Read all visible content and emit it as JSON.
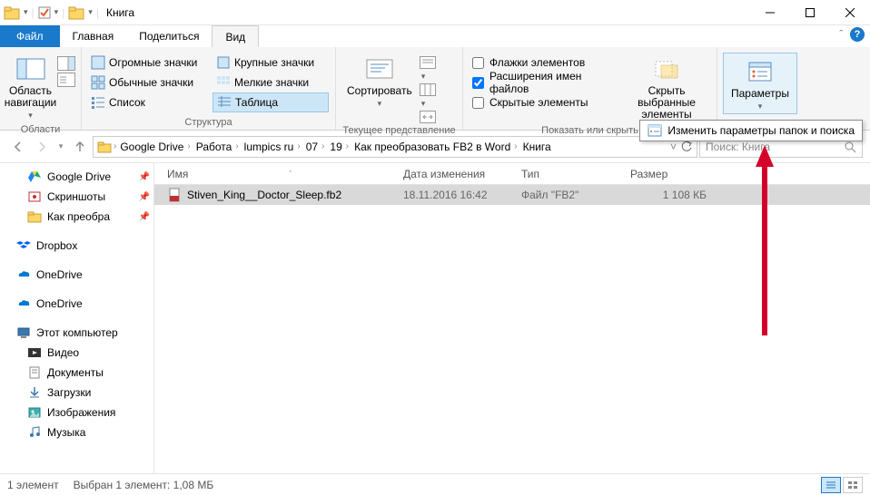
{
  "window_title": "Книга",
  "tabs": {
    "file": "Файл",
    "home": "Главная",
    "share": "Поделиться",
    "view": "Вид"
  },
  "ribbon": {
    "nav_pane": "Область навигации",
    "group_panes": "Области",
    "layout": {
      "huge": "Огромные значки",
      "large": "Крупные значки",
      "normal": "Обычные значки",
      "small": "Мелкие значки",
      "list": "Список",
      "table": "Таблица"
    },
    "group_layout": "Структура",
    "sort": "Сортировать",
    "group_view": "Текущее представление",
    "checks": {
      "boxes": "Флажки элементов",
      "ext": "Расширения имен файлов",
      "hidden": "Скрытые элементы"
    },
    "hide_selected": "Скрыть выбранные элементы",
    "group_show": "Показать или скрыть",
    "params": "Параметры",
    "tooltip": "Изменить параметры папок и поиска"
  },
  "breadcrumb": [
    "Google Drive",
    "Работа",
    "lumpics ru",
    "07",
    "19",
    "Как преобразовать FB2 в Word",
    "Книга"
  ],
  "search_placeholder": "Поиск: Книга",
  "columns": {
    "name": "Имя",
    "date": "Дата изменения",
    "type": "Тип",
    "size": "Размер"
  },
  "files": [
    {
      "name": "Stiven_King__Doctor_Sleep.fb2",
      "date": "18.11.2016 16:42",
      "type": "Файл \"FB2\"",
      "size": "1 108 КБ"
    }
  ],
  "sidebar": {
    "gdrive": "Google Drive",
    "screens": "Скриншоты",
    "convert": "Как преобра",
    "dropbox": "Dropbox",
    "onedrive": "OneDrive",
    "onedrive2": "OneDrive",
    "thispc": "Этот компьютер",
    "video": "Видео",
    "docs": "Документы",
    "downloads": "Загрузки",
    "pictures": "Изображения",
    "music": "Музыка"
  },
  "status": {
    "count": "1 элемент",
    "selected": "Выбран 1 элемент: 1,08 МБ"
  }
}
